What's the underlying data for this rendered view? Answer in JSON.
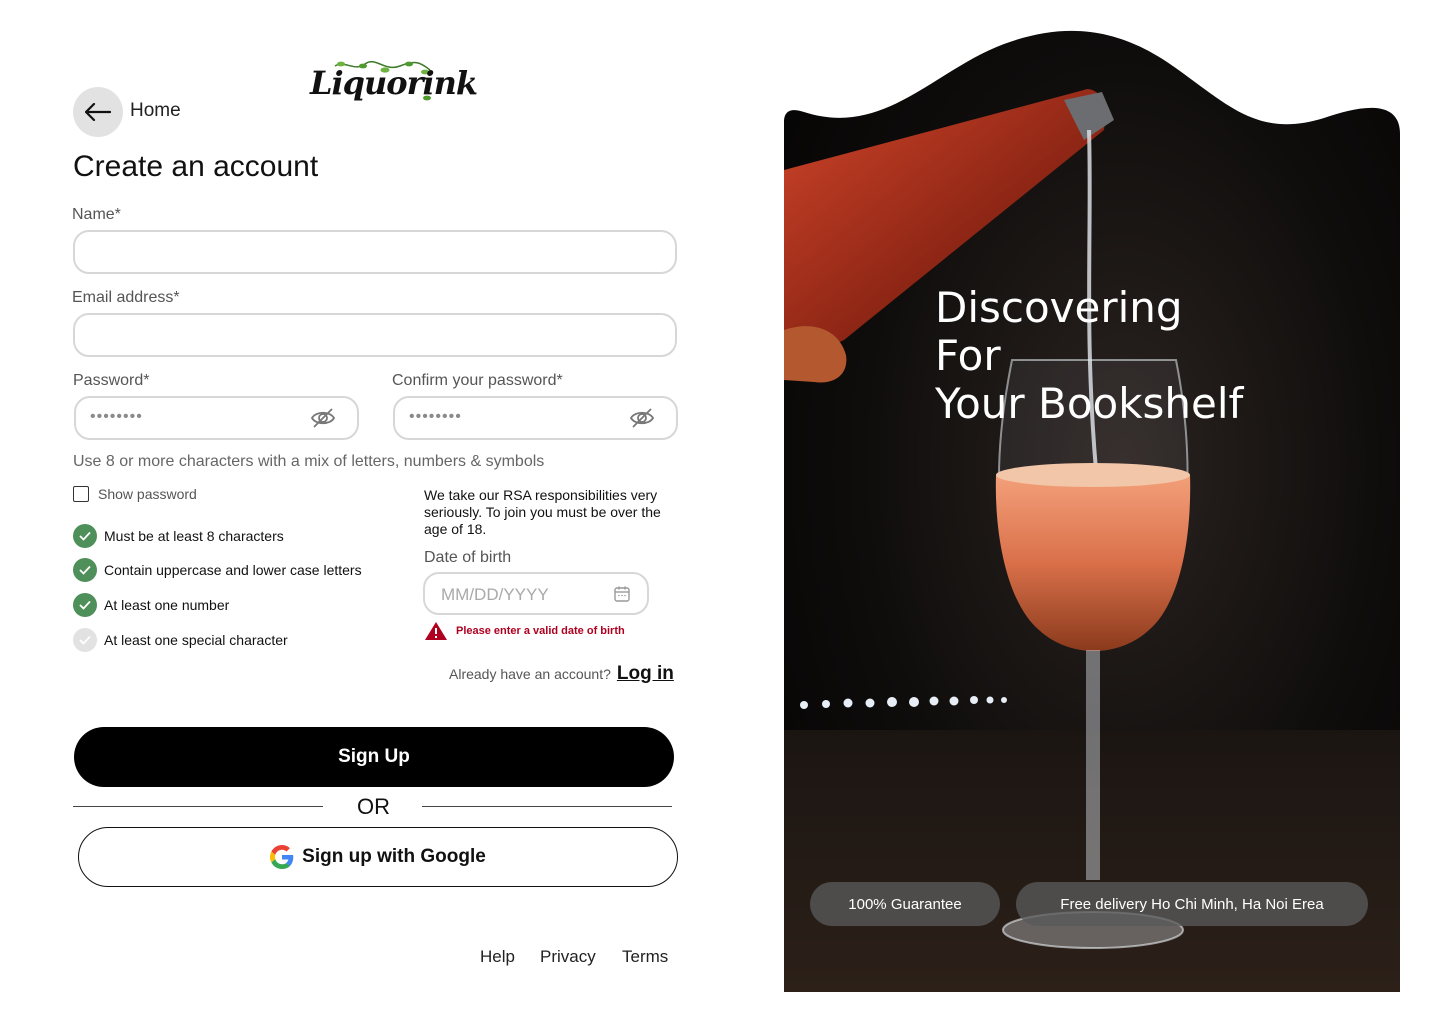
{
  "nav": {
    "home_label": "Home"
  },
  "brand": {
    "logo_text": "Liquorink"
  },
  "form": {
    "title": "Create an account",
    "name_label": "Name*",
    "name_value": "",
    "email_label": "Email address*",
    "email_value": "",
    "password_label": "Password*",
    "password_value": "••••••••",
    "confirm_label": "Confirm your password*",
    "confirm_value": "••••••••",
    "hint": "Use 8 or more characters with a mix of letters, numbers & symbols",
    "show_password_label": "Show password",
    "show_password_checked": false
  },
  "requirements": [
    {
      "label": "Must be at least 8 characters",
      "met": true
    },
    {
      "label": "Contain uppercase and lower case letters",
      "met": true
    },
    {
      "label": "At least one number",
      "met": true
    },
    {
      "label": "At least one special character",
      "met": false
    }
  ],
  "age": {
    "notice": "We take our RSA responsibilities very seriously. To join you must be over the age of 18.",
    "dob_label": "Date of birth",
    "dob_placeholder": "MM/DD/YYYY",
    "error": "Please enter a valid date of birth"
  },
  "login": {
    "prompt": "Already have an account?",
    "link": "Log in"
  },
  "actions": {
    "signup": "Sign Up",
    "or": "OR",
    "google": "Sign up with Google"
  },
  "footer": {
    "help": "Help",
    "privacy": "Privacy",
    "terms": "Terms"
  },
  "hero": {
    "title_line1": "Discovering For",
    "title_line2": "Your Bookshelf",
    "badge_guarantee": "100% Guarantee",
    "badge_delivery": "Free delivery Ho Chi Minh, Ha Noi Erea"
  },
  "colors": {
    "check_ok": "#4f8f5a",
    "error": "#b00020",
    "primary_button": "#000000"
  }
}
